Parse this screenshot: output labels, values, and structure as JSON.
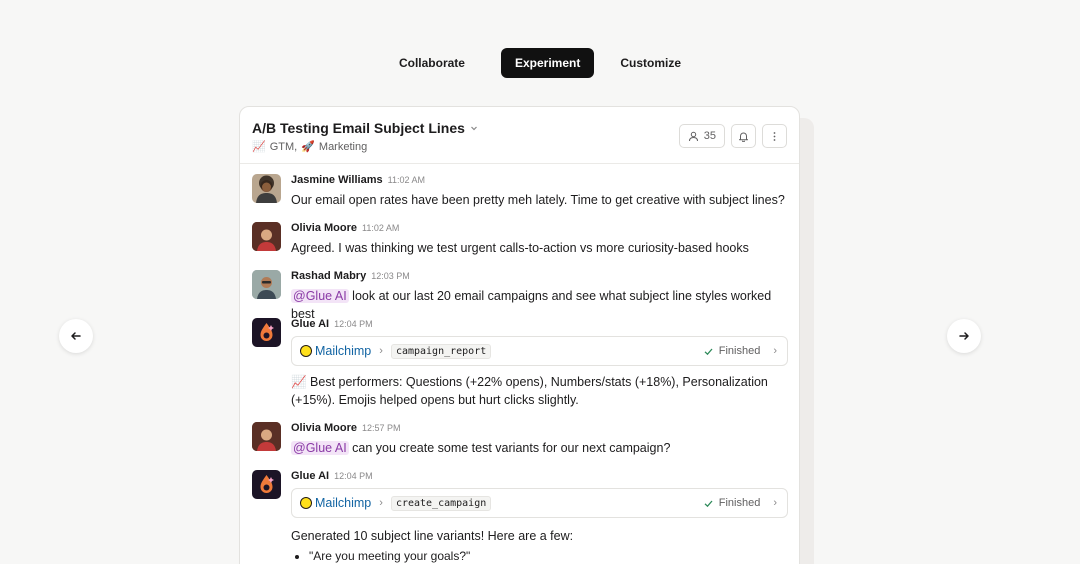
{
  "tabs": [
    {
      "label": "Collaborate"
    },
    {
      "label": "Experiment"
    },
    {
      "label": "Customize"
    }
  ],
  "channel": {
    "title": "A/B Testing Email Subject Lines",
    "tags": [
      {
        "emoji": "📈",
        "label": "GTM,"
      },
      {
        "emoji": "🚀",
        "label": "Marketing"
      }
    ],
    "member_count": "35"
  },
  "messages": [
    {
      "author": "Jasmine Williams",
      "time": "11:02 AM",
      "text": "Our email open rates have been pretty meh lately. Time to get creative with subject lines?"
    },
    {
      "author": "Olivia Moore",
      "time": "11:02 AM",
      "text": "Agreed. I was thinking we test urgent calls-to-action vs more curiosity-based hooks"
    },
    {
      "author": "Rashad Mabry",
      "time": "12:03 PM",
      "mention": "@Glue AI",
      "text": "look at our last 20 email campaigns and see what subject line styles worked best"
    },
    {
      "author": "Glue AI",
      "time": "12:04 PM",
      "tool": "Mailchimp",
      "action": "campaign_report",
      "status": "Finished",
      "text": "📈 Best performers: Questions (+22% opens), Numbers/stats (+18%), Personalization (+15%). Emojis helped opens but hurt clicks slightly."
    },
    {
      "author": "Olivia Moore",
      "time": "12:57 PM",
      "mention": "@Glue AI",
      "text": "can you create some test variants for our next campaign?"
    },
    {
      "author": "Glue AI",
      "time": "12:04 PM",
      "tool": "Mailchimp",
      "action": "create_campaign",
      "status": "Finished",
      "text": "Generated 10 subject line variants! Here are a few:",
      "bullets": [
        "\"Are you meeting your goals?\""
      ]
    }
  ]
}
